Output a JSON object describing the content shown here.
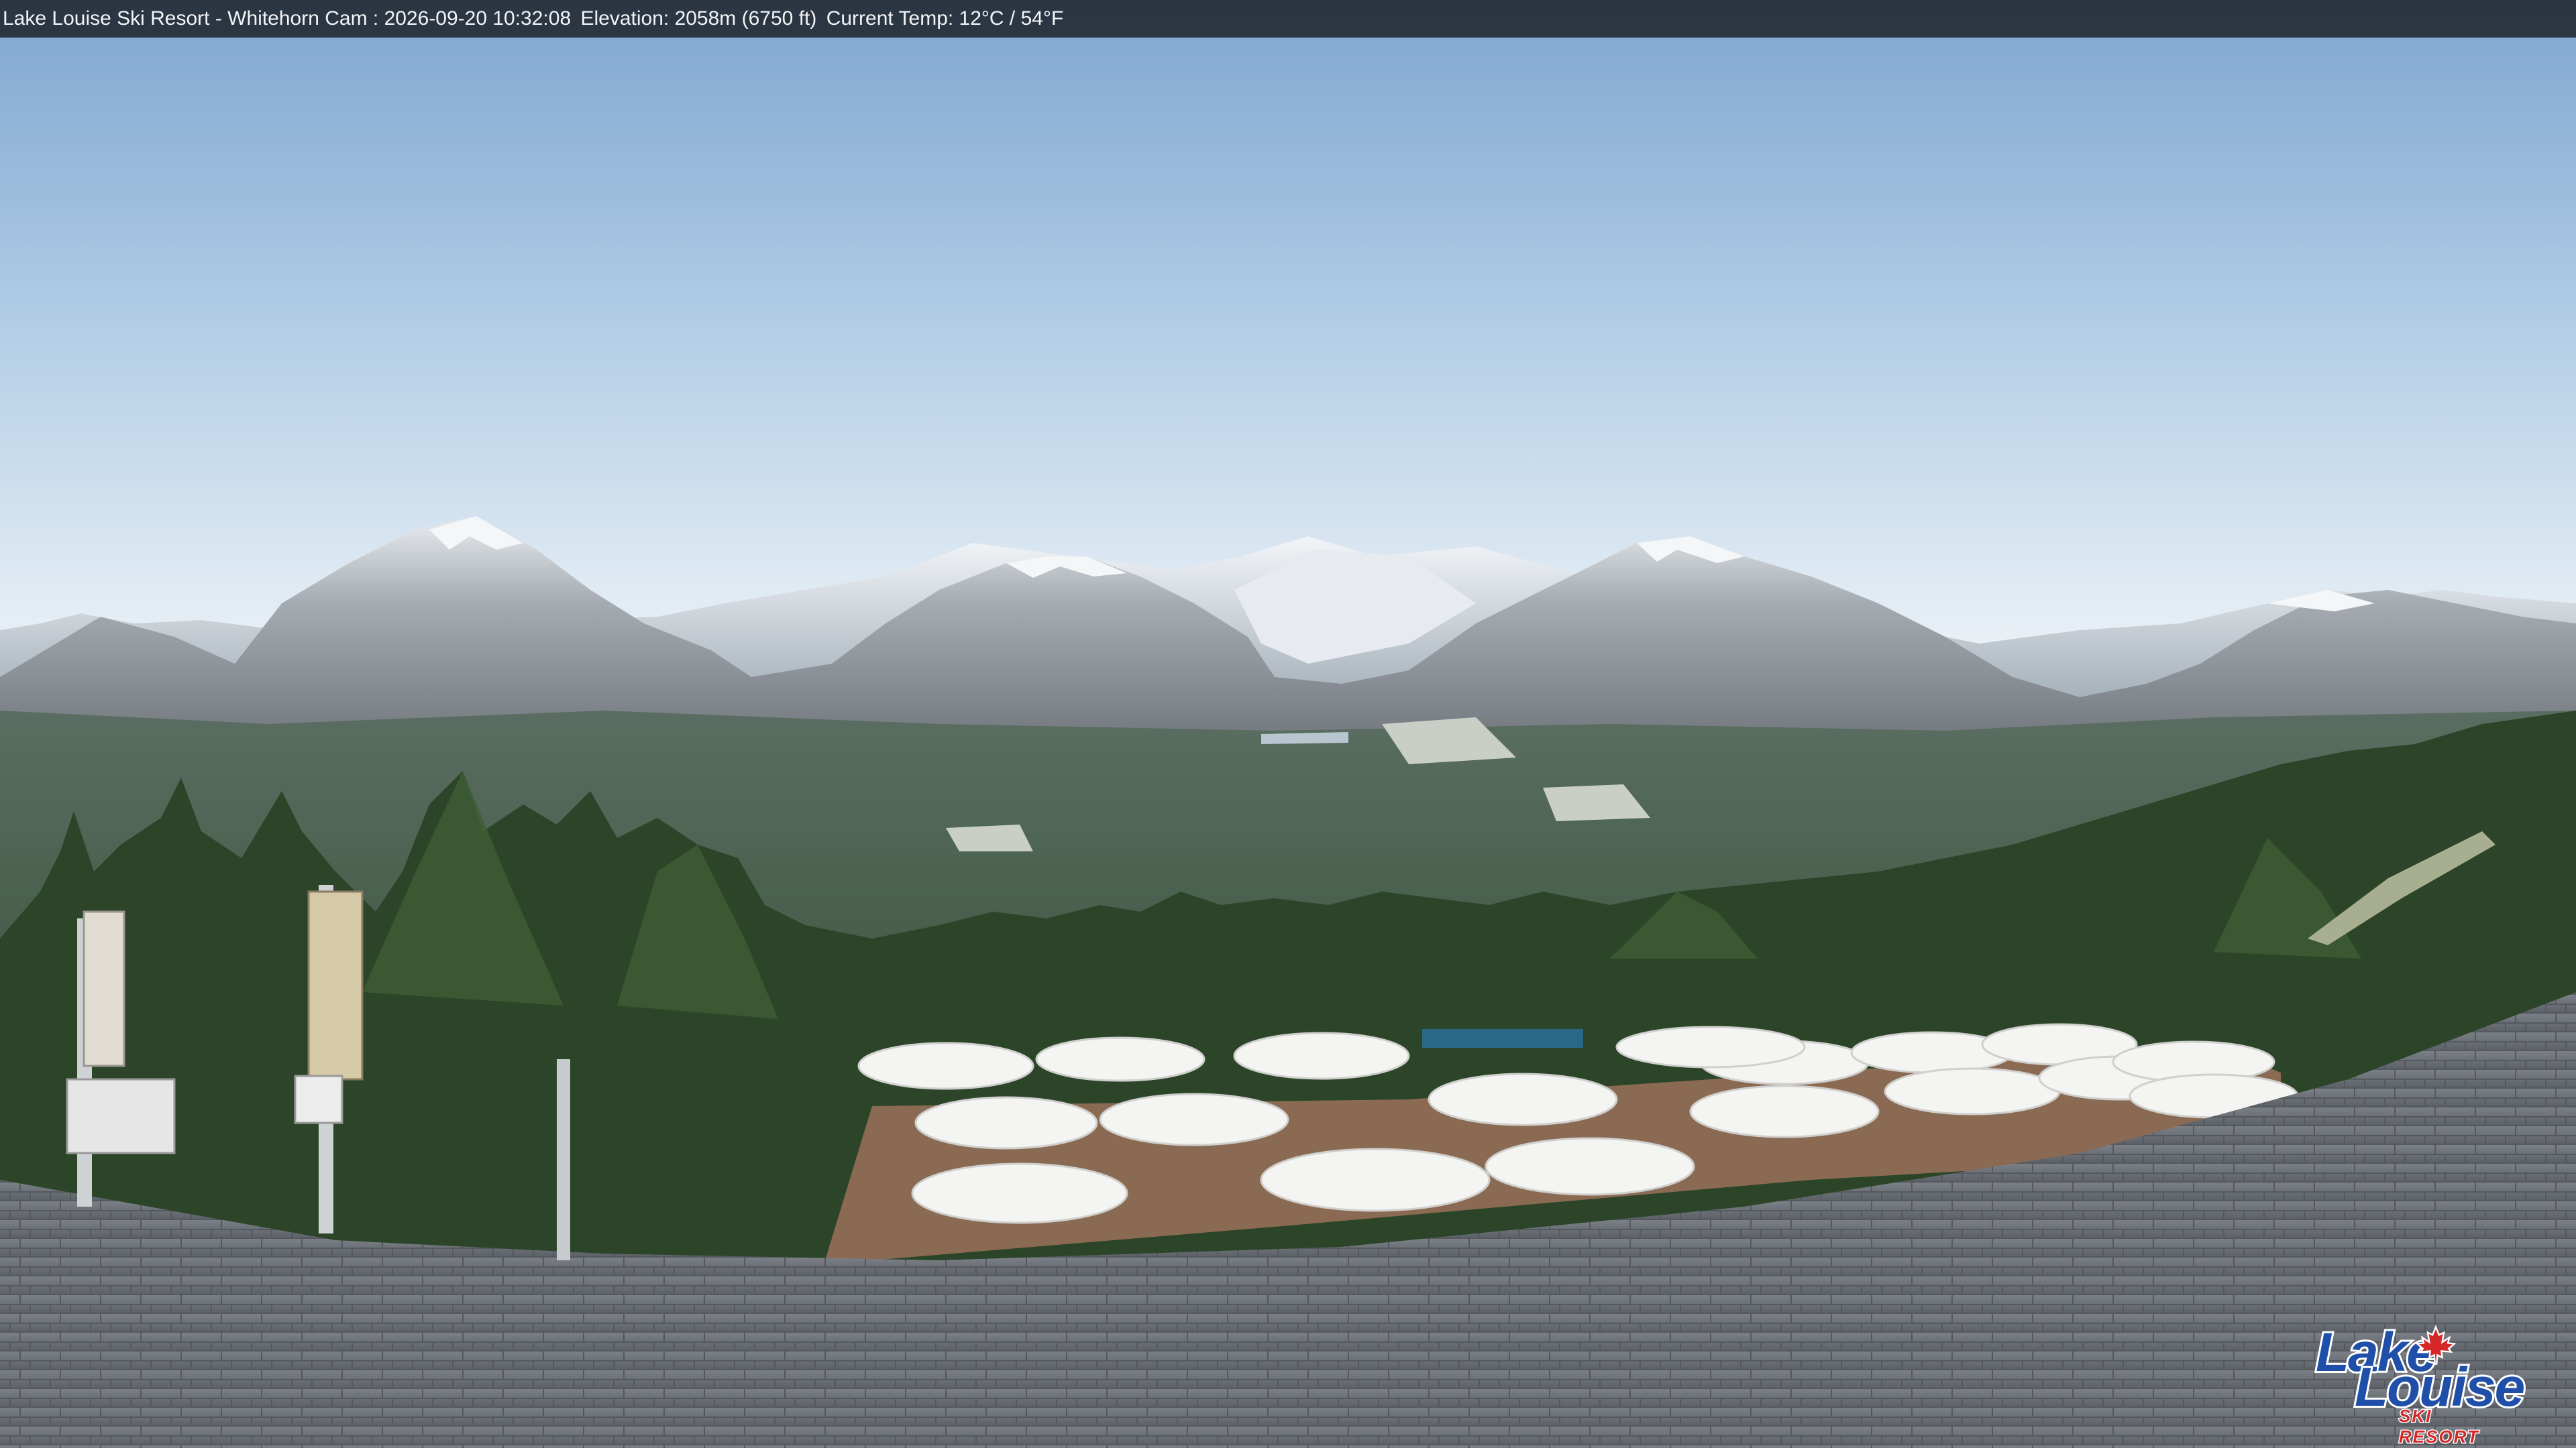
{
  "camera": {
    "title": "Lake Louise Ski Resort - Whitehorn Cam : 2026-09-20 10:32:08",
    "elevation": "Elevation: 2058m (6750 ft)",
    "temperature": "Current Temp: 12°C / 54°F"
  },
  "logo": {
    "line1": "Lake",
    "line2": "Louise",
    "tagline": "SKI RESORT",
    "leaf_color": "#d62828",
    "text_color": "#1f4fa8"
  },
  "colors": {
    "sky_top": "#7fa6d1",
    "sky_horizon": "#eef3f7",
    "forest": "#2f4a2c",
    "roof": "#6e7278"
  }
}
